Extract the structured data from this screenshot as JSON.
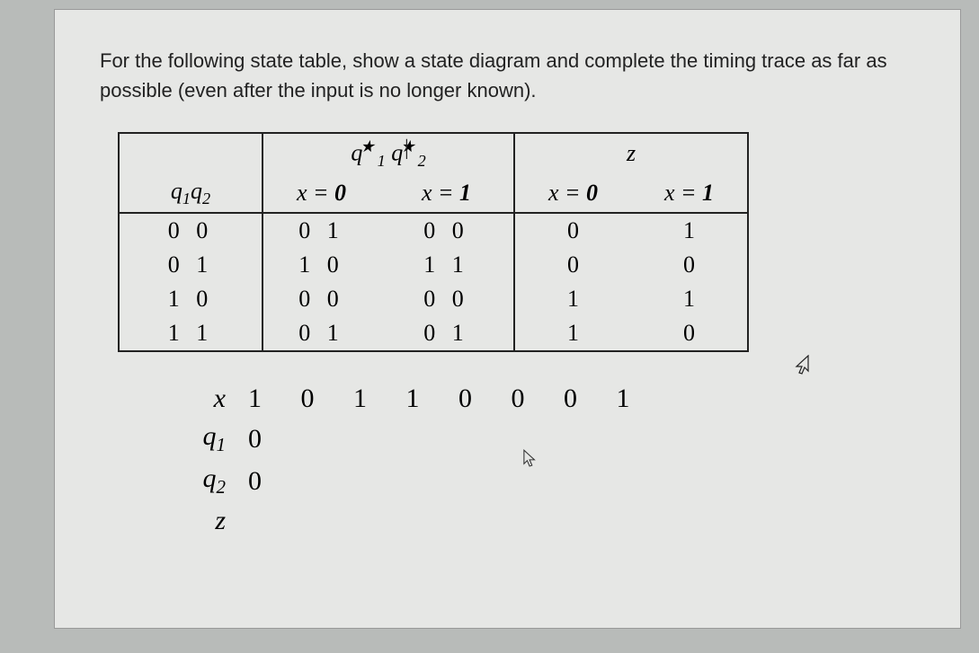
{
  "instruction": "For the following state table, show a state diagram and complete the timing trace as far as possible (even after the input is no longer known).",
  "table": {
    "header": {
      "state_label": "q₁q₂",
      "next_state_label": "q₁★ q₂★",
      "output_label": "z",
      "x0": "x = 0",
      "x1": "x = 1"
    },
    "rows": [
      {
        "state": "0 0",
        "ns0": "0 1",
        "ns1": "0 0",
        "z0": "0",
        "z1": "1"
      },
      {
        "state": "0 1",
        "ns0": "1 0",
        "ns1": "1 1",
        "z0": "0",
        "z1": "0"
      },
      {
        "state": "1 0",
        "ns0": "0 0",
        "ns1": "0 0",
        "z0": "1",
        "z1": "1"
      },
      {
        "state": "1 1",
        "ns0": "0 1",
        "ns1": "0 1",
        "z0": "1",
        "z1": "0"
      }
    ]
  },
  "trace": {
    "x_label": "x",
    "x_values": "1 0 1 1 0 0 0 1",
    "q1_label": "q₁",
    "q1_values": "0",
    "q2_label": "q₂",
    "q2_values": "0",
    "z_label": "z",
    "z_values": ""
  }
}
